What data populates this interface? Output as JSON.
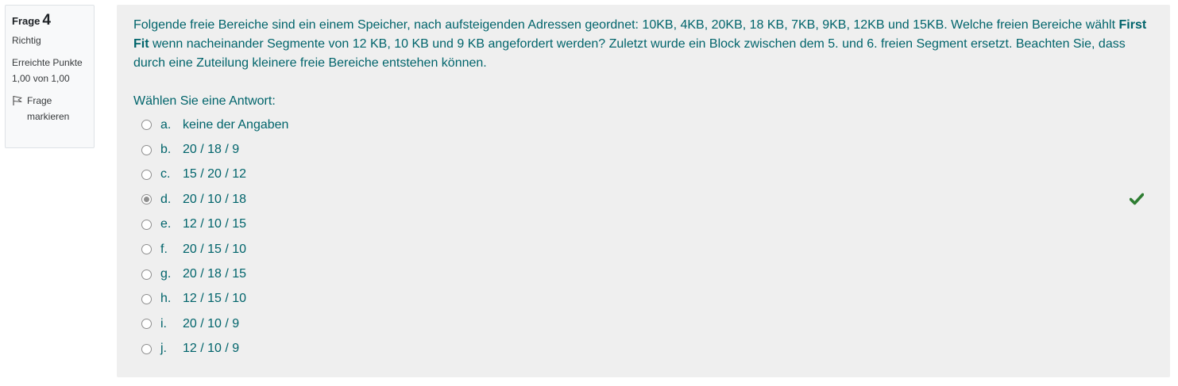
{
  "info": {
    "label": "Frage",
    "number": "4",
    "state": "Richtig",
    "grade": "Erreichte Punkte 1,00 von 1,00",
    "flag_label": "Frage markieren"
  },
  "question": {
    "text_part1": "Folgende freie Bereiche sind ein einem Speicher, nach aufsteigenden Adressen geordnet: 10KB, 4KB, 20KB, 18 KB, 7KB, 9KB, 12KB und 15KB. Welche freien Bereiche wählt ",
    "text_bold": "First Fit",
    "text_part2": " wenn nacheinander Segmente von 12 KB, 10 KB und 9 KB angefordert werden? Zuletzt wurde ein Block zwischen dem 5. und 6. freien Segment ersetzt. Beachten Sie, dass durch eine Zuteilung kleinere freie Bereiche entstehen können.",
    "prompt": "Wählen Sie eine Antwort:"
  },
  "answers": [
    {
      "letter": "a.",
      "text": "keine der Angaben",
      "checked": false
    },
    {
      "letter": "b.",
      "text": "20 / 18 / 9",
      "checked": false
    },
    {
      "letter": "c.",
      "text": "15 / 20 / 12",
      "checked": false
    },
    {
      "letter": "d.",
      "text": "20 / 10 / 18",
      "checked": true
    },
    {
      "letter": "e.",
      "text": "12 / 10 / 15",
      "checked": false
    },
    {
      "letter": "f.",
      "text": "20 / 15 / 10",
      "checked": false
    },
    {
      "letter": "g.",
      "text": "20 / 18 / 15",
      "checked": false
    },
    {
      "letter": "h.",
      "text": "12 / 15 / 10",
      "checked": false
    },
    {
      "letter": "i.",
      "text": "20 / 10 / 9",
      "checked": false
    },
    {
      "letter": "j.",
      "text": "12 / 10 / 9",
      "checked": false
    }
  ],
  "icons": {
    "flag": "flag-icon",
    "correct": "checkmark-icon"
  },
  "colors": {
    "question_text": "#00646b",
    "correct_check": "#2e7d32",
    "panel_background": "#efefef"
  }
}
